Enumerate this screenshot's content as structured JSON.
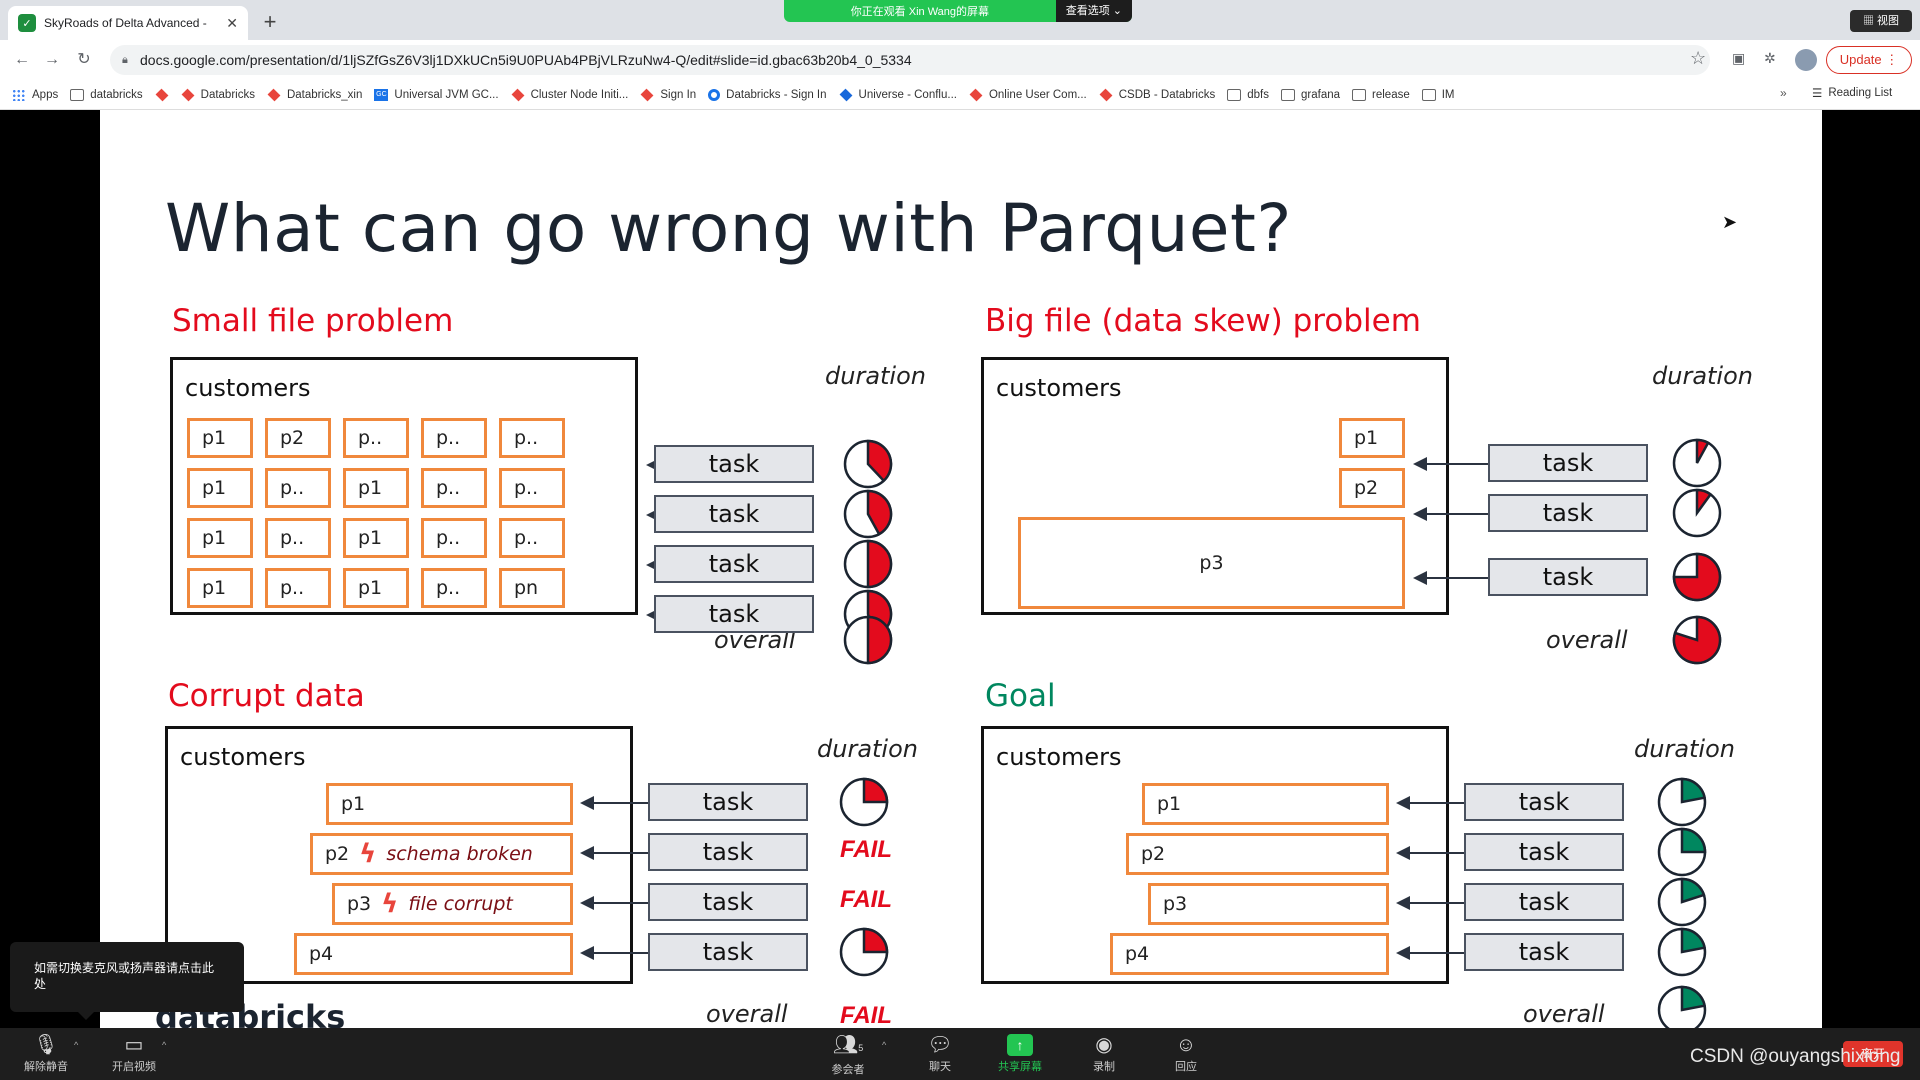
{
  "browser": {
    "tab_title": "SkyRoads of Delta Advanced -",
    "banner_text": "你正在观看 Xin Wang的屏幕",
    "banner_options": "查看选项",
    "view_button": "视图",
    "url": "docs.google.com/presentation/d/1ljSZfGsZ6V3lj1DXkUCn5i9U0PUAb4PBjVLRzuNw4-Q/edit#slide=id.gbac63b20b4_0_5334",
    "update_label": "Update",
    "bookmarks": [
      {
        "label": "Apps",
        "icon": "grid"
      },
      {
        "label": "databricks",
        "icon": "folder"
      },
      {
        "label": "",
        "icon": "cube"
      },
      {
        "label": "Databricks",
        "icon": "cube"
      },
      {
        "label": "Databricks_xin",
        "icon": "cube"
      },
      {
        "label": "Universal JVM GC...",
        "icon": "gc"
      },
      {
        "label": "Cluster Node Initi...",
        "icon": "cube"
      },
      {
        "label": "Sign In",
        "icon": "cube"
      },
      {
        "label": "Databricks - Sign In",
        "icon": "circle"
      },
      {
        "label": "Universe - Conflu...",
        "icon": "conf"
      },
      {
        "label": "Online User Com...",
        "icon": "cube"
      },
      {
        "label": "CSDB - Databricks",
        "icon": "cube"
      },
      {
        "label": "dbfs",
        "icon": "folder"
      },
      {
        "label": "grafana",
        "icon": "folder"
      },
      {
        "label": "release",
        "icon": "folder"
      },
      {
        "label": "IM",
        "icon": "folder"
      }
    ],
    "reading_list": "Reading List"
  },
  "slide": {
    "title": "What can go wrong with Parquet?",
    "customers": "customers",
    "duration": "duration",
    "overall": "overall",
    "task": "task",
    "fail": "FAIL",
    "logo": "databricks",
    "small": {
      "heading": "Small file problem",
      "rows": [
        [
          "p1",
          "p2",
          "p..",
          "p..",
          "p.."
        ],
        [
          "p1",
          "p..",
          "p1",
          "p..",
          "p.."
        ],
        [
          "p1",
          "p..",
          "p1",
          "p..",
          "p.."
        ],
        [
          "p1",
          "p..",
          "p1",
          "p..",
          "pn"
        ]
      ],
      "pie_fractions": [
        0.38,
        0.42,
        0.5,
        0.46
      ],
      "overall_fraction": 0.5
    },
    "big": {
      "heading": "Big file (data skew) problem",
      "parts": [
        "p1",
        "p2",
        "p3"
      ],
      "pie_fractions": [
        0.08,
        0.1,
        0.75
      ],
      "overall_fraction": 0.8
    },
    "corrupt": {
      "heading": "Corrupt data",
      "parts": [
        "p1",
        "p2",
        "p3",
        "p4"
      ],
      "notes": [
        "",
        "schema broken",
        "file corrupt",
        ""
      ],
      "results": [
        "pie",
        "FAIL",
        "FAIL",
        "pie"
      ],
      "pie_fractions": [
        0.25,
        0,
        0,
        0.25
      ]
    },
    "goal": {
      "heading": "Goal",
      "parts": [
        "p1",
        "p2",
        "p3",
        "p4"
      ],
      "pie_fractions": [
        0.22,
        0.25,
        0.2,
        0.22
      ],
      "overall_fraction": 0.22
    },
    "colors": {
      "red": "#e30b1d",
      "green": "#00875f",
      "orange": "#f0883c"
    }
  },
  "tooltip": "如需切换麦克风或扬声器请点击此处",
  "zoom": {
    "unmute": "解除静音",
    "video": "开启视频",
    "participants": "参会者",
    "participants_count": "5",
    "chat": "聊天",
    "share": "共享屏幕",
    "record": "录制",
    "react": "回应",
    "leave": "离开"
  },
  "watermark": "CSDN @ouyangshixiong"
}
